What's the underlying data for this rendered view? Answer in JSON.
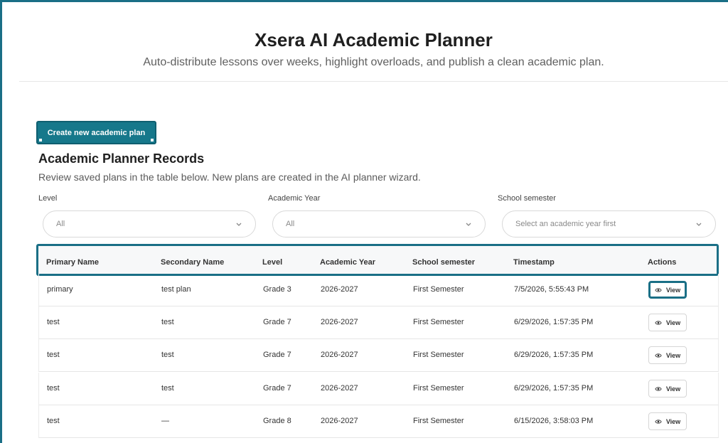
{
  "header": {
    "title": "Xsera AI Academic Planner",
    "subtitle": "Auto-distribute lessons over weeks, highlight overloads, and publish a clean academic plan."
  },
  "actions": {
    "create_label": "Create new academic plan"
  },
  "records": {
    "title": "Academic Planner Records",
    "description": "Review saved plans in the table below. New plans are created in the AI planner wizard."
  },
  "filters": {
    "level": {
      "label": "Level",
      "value": "All"
    },
    "academic_year": {
      "label": "Academic Year",
      "value": "All"
    },
    "semester": {
      "label": "School semester",
      "value": "Select an academic year first"
    }
  },
  "table": {
    "columns": [
      "Primary Name",
      "Secondary Name",
      "Level",
      "Academic Year",
      "School semester",
      "Timestamp",
      "Actions"
    ],
    "view_label": "View",
    "rows": [
      {
        "primary": "primary",
        "secondary": "test plan",
        "level": "Grade 3",
        "year": "2026-2027",
        "semester": "First Semester",
        "timestamp": "7/5/2026, 5:55:43 PM"
      },
      {
        "primary": "test",
        "secondary": "test",
        "level": "Grade 7",
        "year": "2026-2027",
        "semester": "First Semester",
        "timestamp": "6/29/2026, 1:57:35 PM"
      },
      {
        "primary": "test",
        "secondary": "test",
        "level": "Grade 7",
        "year": "2026-2027",
        "semester": "First Semester",
        "timestamp": "6/29/2026, 1:57:35 PM"
      },
      {
        "primary": "test",
        "secondary": "test",
        "level": "Grade 7",
        "year": "2026-2027",
        "semester": "First Semester",
        "timestamp": "6/29/2026, 1:57:35 PM"
      },
      {
        "primary": "test",
        "secondary": "—",
        "level": "Grade 8",
        "year": "2026-2027",
        "semester": "First Semester",
        "timestamp": "6/15/2026, 3:58:03 PM"
      }
    ]
  },
  "colors": {
    "accent": "#1a6f86",
    "button": "#16788b"
  }
}
